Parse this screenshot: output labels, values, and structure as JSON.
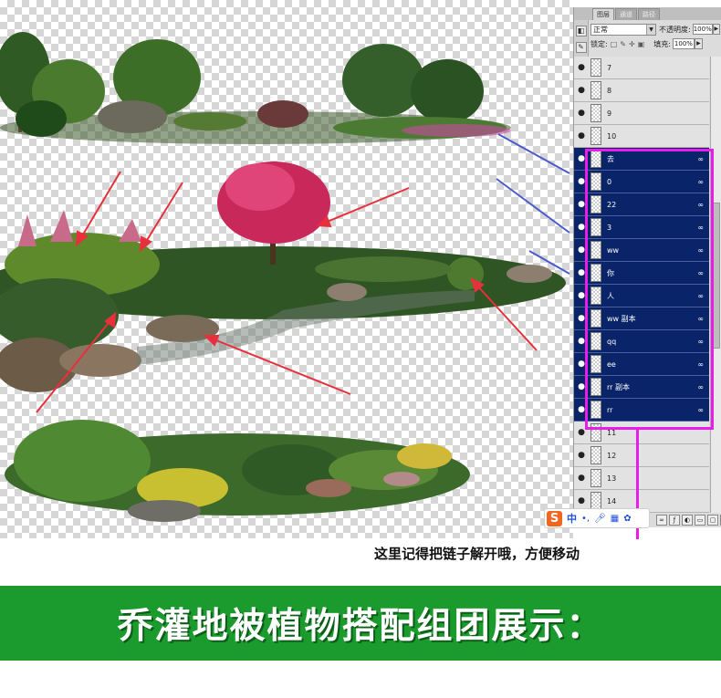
{
  "panel": {
    "tabs": [
      "图层",
      "通道",
      "路径"
    ],
    "blend_mode": "正常",
    "opacity_label": "不透明度:",
    "opacity_value": "100%",
    "lock_label": "锁定:",
    "fill_label": "填充:",
    "fill_value": "100%",
    "link_glyph": "∞",
    "eye_glyph": "●",
    "layers": [
      {
        "name": "7",
        "selected": false,
        "linked": false
      },
      {
        "name": "8",
        "selected": false,
        "linked": false
      },
      {
        "name": "9",
        "selected": false,
        "linked": false
      },
      {
        "name": "10",
        "selected": false,
        "linked": false
      },
      {
        "name": "去",
        "selected": true,
        "linked": true
      },
      {
        "name": "0",
        "selected": true,
        "linked": true
      },
      {
        "name": "22",
        "selected": true,
        "linked": true
      },
      {
        "name": "3",
        "selected": true,
        "linked": true
      },
      {
        "name": "ww",
        "selected": true,
        "linked": true
      },
      {
        "name": "你",
        "selected": true,
        "linked": true
      },
      {
        "name": "人",
        "selected": true,
        "linked": true
      },
      {
        "name": "ww 副本",
        "selected": true,
        "linked": true
      },
      {
        "name": "qq",
        "selected": true,
        "linked": true
      },
      {
        "name": "ee",
        "selected": true,
        "linked": true
      },
      {
        "name": "rr 副本",
        "selected": true,
        "linked": true
      },
      {
        "name": "rr",
        "selected": true,
        "linked": true
      },
      {
        "name": "11",
        "selected": false,
        "linked": false
      },
      {
        "name": "12",
        "selected": false,
        "linked": false
      },
      {
        "name": "13",
        "selected": false,
        "linked": false
      },
      {
        "name": "14",
        "selected": false,
        "linked": false
      }
    ]
  },
  "ime": {
    "logo": "S",
    "mode": "中"
  },
  "note": "这里记得把链子解开哦，方便移动",
  "banner": {
    "title": "乔灌地被植物搭配组团展示："
  },
  "colors": {
    "highlight": "#e81ee8",
    "selected_layer": "#0a246a",
    "banner": "#1b9a2e"
  }
}
